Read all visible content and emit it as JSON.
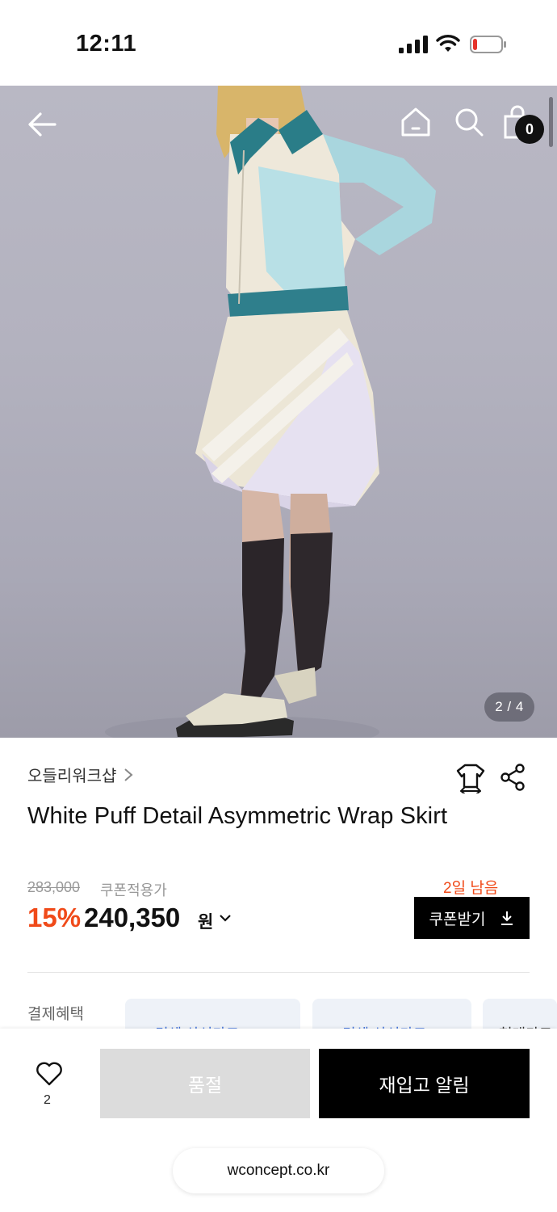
{
  "status_bar": {
    "time": "12:11"
  },
  "nav": {
    "back_icon": "arrow-left-icon",
    "home_icon": "home-icon",
    "search_icon": "search-icon",
    "bag_icon": "shopping-bag-icon",
    "bag_count": "0"
  },
  "gallery": {
    "pager": "2 / 4"
  },
  "product": {
    "brand": "오들리워크샵",
    "title": "White Puff Detail Asymmetric Wrap Skirt",
    "original_price": "283,000",
    "coupon_note": "쿠폰적용가",
    "discount": "15%",
    "price": "240,350",
    "price_unit": "원"
  },
  "coupon": {
    "days_left": "2일 남음",
    "button_label": "쿠폰받기"
  },
  "benefits": {
    "label": "결제혜택",
    "cards": [
      "W컨셉 삼성카드",
      "W컨셉 삼성카드",
      "현대카드"
    ]
  },
  "bottom_bar": {
    "like_count": "2",
    "soldout_label": "품절",
    "restock_label": "재입고 알림"
  },
  "browser": {
    "url": "wconcept.co.kr"
  },
  "colors": {
    "accent_orange": "#f04a19",
    "black": "#000000",
    "soldout_gray": "#dcdcdc",
    "card_blue": "#3d6fd8"
  }
}
